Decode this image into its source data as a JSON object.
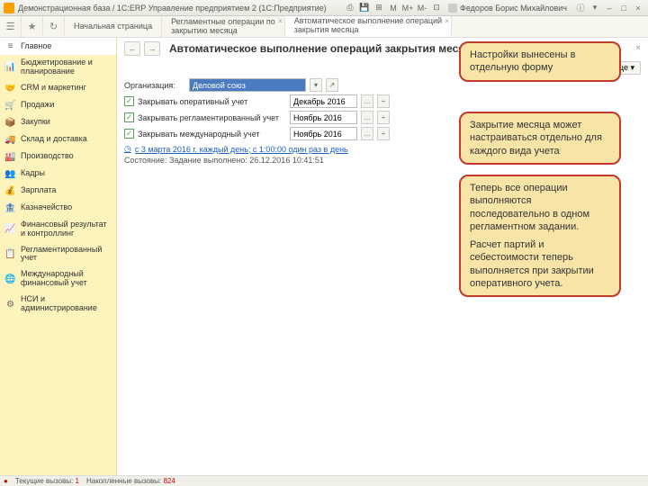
{
  "titlebar": {
    "title": "Демонстрационная база / 1С:ERP Управление предприятием 2  (1С:Предприятие)",
    "user": "Федоров Борис Михайлович",
    "m_buttons": [
      "M",
      "M+",
      "M-"
    ]
  },
  "toolbar": {
    "tabs": [
      {
        "label": "Начальная страница"
      },
      {
        "line1": "Регламентные операции по",
        "line2": "закрытию месяца"
      },
      {
        "line1": "Автоматическое выполнение операций",
        "line2": "закрытия месяца"
      }
    ]
  },
  "sidebar": {
    "items": [
      "Главное",
      "Бюджетирование и планирование",
      "CRM и маркетинг",
      "Продажи",
      "Закупки",
      "Склад и доставка",
      "Производство",
      "Кадры",
      "Зарплата",
      "Казначейство",
      "Финансовый результат и контроллинг",
      "Регламентированный учет",
      "Международный финансовый учет",
      "НСИ и администрирование"
    ]
  },
  "page": {
    "title": "Автоматическое выполнение операций закрытия месяца",
    "more": "Еще",
    "org_label": "Организация:",
    "org_value": "Деловой союз",
    "rows": [
      {
        "label": "Закрывать оперативный учет",
        "month": "Декабрь 2016"
      },
      {
        "label": "Закрывать регламентированный учет",
        "month": "Ноябрь 2016"
      },
      {
        "label": "Закрывать международный учет",
        "month": "Ноябрь 2016"
      }
    ],
    "schedule": "с 3 марта 2016 г. каждый  день; с 1:00:00 один раз в день",
    "status_label": "Состояние:",
    "status_value": "Задание выполнено: 26.12.2016 10:41:51"
  },
  "callouts": {
    "c1": "Настройки вынесены в отдельную форму",
    "c2": "Закрытие месяца может настраиваться отдельно для каждого вида учета",
    "c3a": "Теперь все операции выполняются последовательно в одном регламентном задании.",
    "c3b": "Расчет партий и себестоимости теперь выполняется при закрытии оперативного учета."
  },
  "statusbar": {
    "current_label": "Текущие вызовы:",
    "current_value": "1",
    "accum_label": "Накопленные вызовы:",
    "accum_value": "824"
  }
}
